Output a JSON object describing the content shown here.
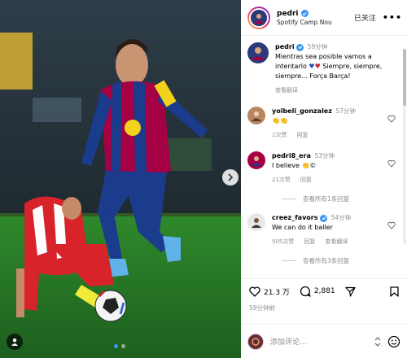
{
  "post": {
    "username": "pedri",
    "location": "Spotify Camp Nou",
    "follow_label": "已关注",
    "more_label": "•••"
  },
  "caption": {
    "username": "pedri",
    "time": "59分钟",
    "text": "Mientras sea posible vamos a intentarlo",
    "text2": "Siempre, siempre, siempre... Força Barça!",
    "translate": "查看翻译"
  },
  "comments": [
    {
      "username": "yolbeli_gonzalez",
      "time": "57分钟",
      "text": "👏👏",
      "likes": "2次赞",
      "reply": "回复"
    },
    {
      "username": "pedri8_era",
      "time": "53分钟",
      "text": "I believe 👏©",
      "likes": "21次赞",
      "reply": "回复",
      "view_replies": "查看所有1条回复"
    },
    {
      "username": "creez_favors",
      "time": "54分钟",
      "text": "We can do it baller",
      "likes": "505次赞",
      "reply": "回复",
      "translate": "查看翻译",
      "view_replies": "查看所有3条回复"
    }
  ],
  "stats": {
    "likes": "21.3 万",
    "comments": "2,881",
    "posted": "59分钟前"
  },
  "comment_input": {
    "placeholder": "添加评论…"
  },
  "carousel": {
    "current": 1,
    "total": 2
  },
  "colors": {
    "verified": "#3897f0",
    "barca_blue": "#1b3b8c",
    "barca_red": "#a50044"
  }
}
